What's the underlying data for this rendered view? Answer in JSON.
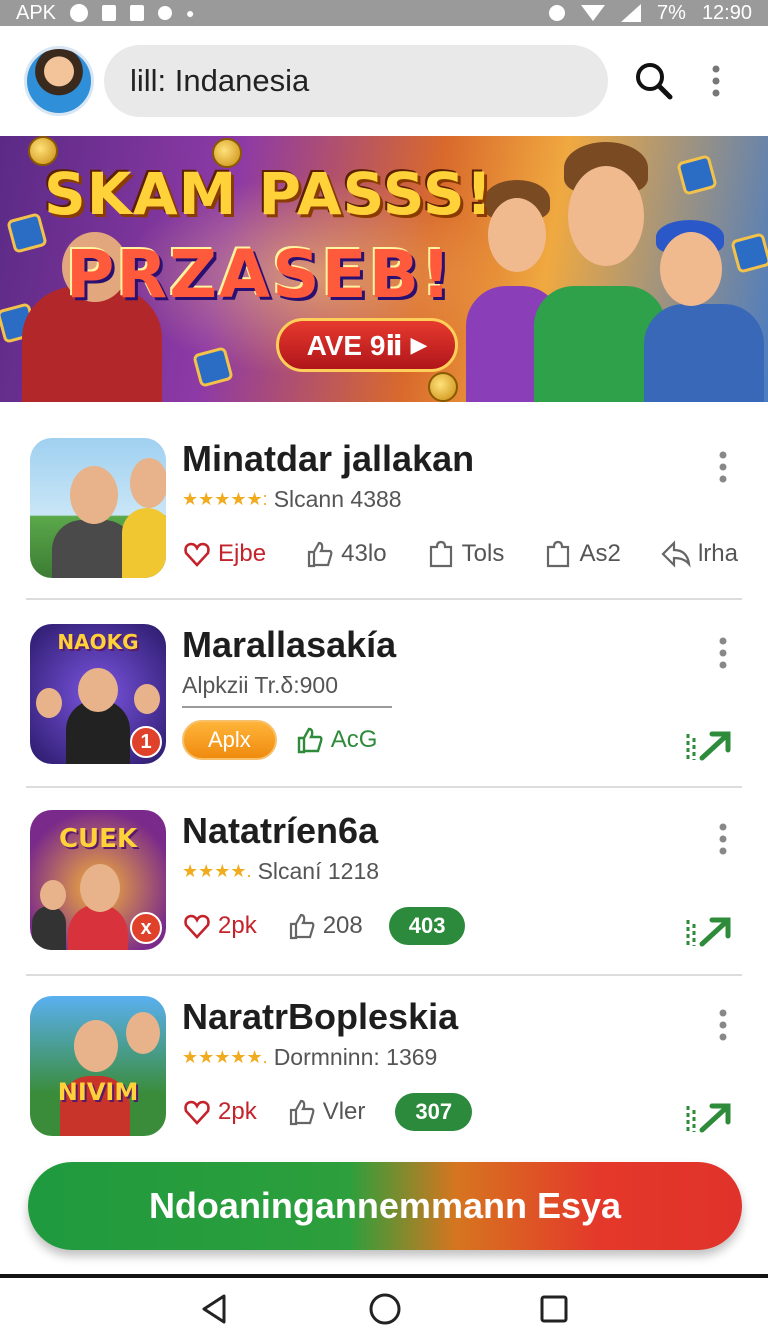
{
  "status_bar": {
    "left_label": "APK",
    "battery": "7%",
    "time": "12:90"
  },
  "topbar": {
    "search_text": "lill: Indanesia"
  },
  "banner": {
    "line1": "SKAM PASSS!",
    "line2": "PRZASEB!",
    "cta_label": "AVE 9ⅱ"
  },
  "items": [
    {
      "title": "Minatdar jallakan",
      "stars": "★★★★★:",
      "subtitle": "Slcann 4388",
      "actions": [
        "Ejbe",
        "43lo",
        "Tols",
        "As2",
        "lrha"
      ]
    },
    {
      "title": "Marallasakía",
      "subtitle": "Alpkzii Tr.δ:900",
      "pill": "Aplx",
      "action": "AcG"
    },
    {
      "title": "Natatríen6a",
      "stars": "★★★★.",
      "subtitle": "Slcaní 1218",
      "actions": [
        "2pk",
        "208"
      ],
      "pill": "403",
      "thumb_word": "CUEK"
    },
    {
      "title": "NaratrBopleskia",
      "stars": "★★★★★.",
      "subtitle": "Dormninn: 1369",
      "actions": [
        "2pk",
        "Vler"
      ],
      "pill": "307",
      "thumb_word": "NIVIM"
    }
  ],
  "thumb_words": {
    "item2": "NAOKG"
  },
  "bottom_cta": "Ndoaningannemmann Esya",
  "colors": {
    "accent_green": "#2b8a3b",
    "accent_red": "#c4232b",
    "star": "#f0ab1f"
  }
}
